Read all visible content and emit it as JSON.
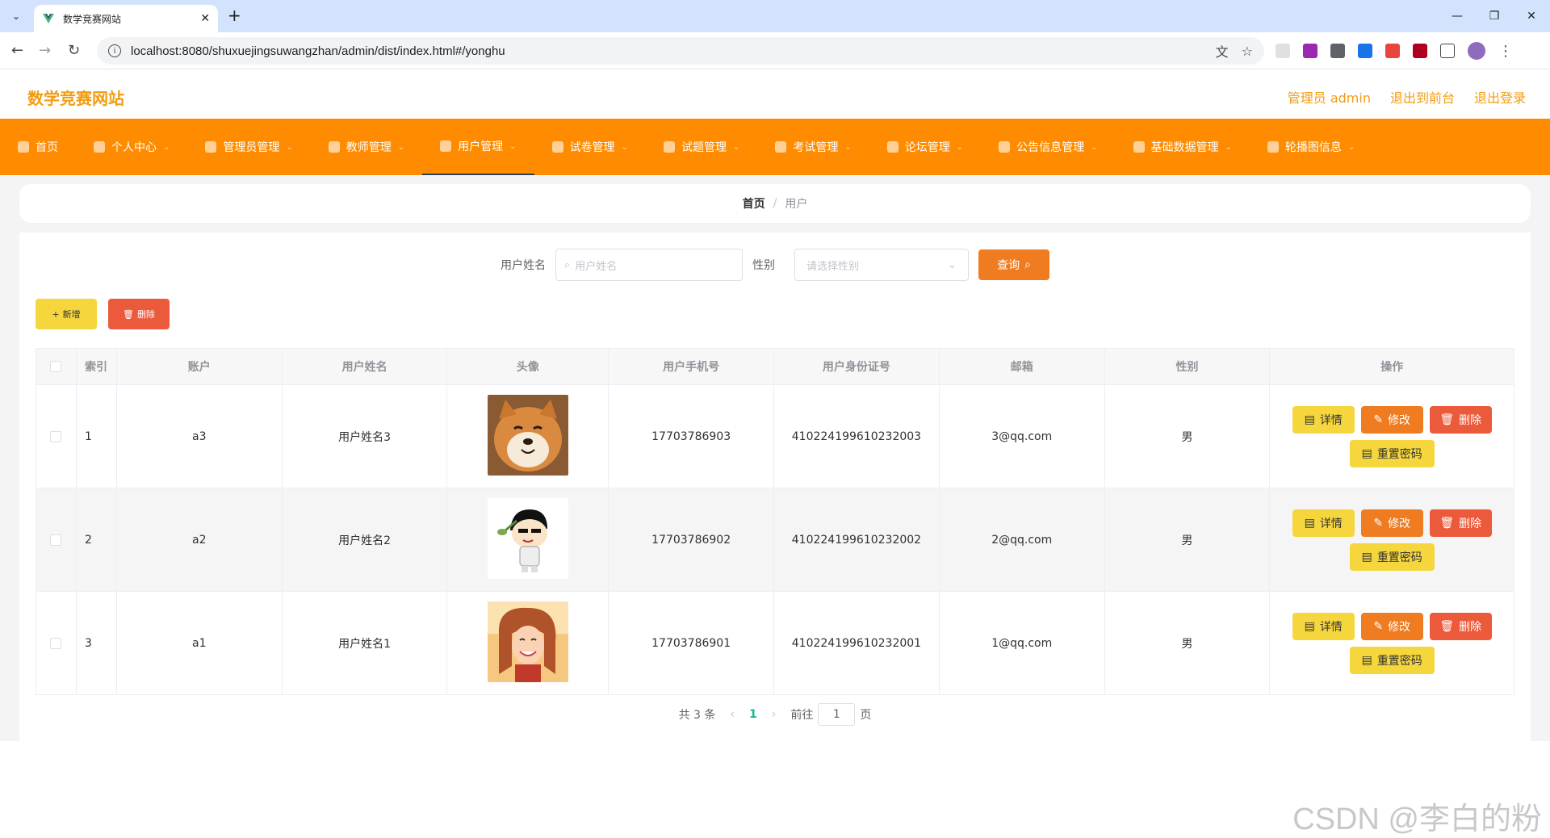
{
  "browser": {
    "tab_title": "数学竞赛网站",
    "url": "localhost:8080/shuxuejingsuwangzhan/admin/dist/index.html#/yonghu"
  },
  "header": {
    "site_title": "数学竞赛网站",
    "links": [
      "管理员 admin",
      "退出到前台",
      "退出登录"
    ]
  },
  "menu": {
    "items": [
      {
        "label": "首页",
        "has_arrow": false
      },
      {
        "label": "个人中心",
        "has_arrow": true
      },
      {
        "label": "管理员管理",
        "has_arrow": true
      },
      {
        "label": "教师管理",
        "has_arrow": true
      },
      {
        "label": "用户管理",
        "has_arrow": true,
        "active": true
      },
      {
        "label": "试卷管理",
        "has_arrow": true
      },
      {
        "label": "试题管理",
        "has_arrow": true
      },
      {
        "label": "考试管理",
        "has_arrow": true
      },
      {
        "label": "论坛管理",
        "has_arrow": true
      },
      {
        "label": "公告信息管理",
        "has_arrow": true
      },
      {
        "label": "基础数据管理",
        "has_arrow": true
      },
      {
        "label": "轮播图信息",
        "has_arrow": true
      }
    ]
  },
  "breadcrumb": {
    "home": "首页",
    "sep": "/",
    "current": "用户"
  },
  "search": {
    "name_label": "用户姓名",
    "name_placeholder": "用户姓名",
    "gender_label": "性别",
    "gender_placeholder": "请选择性别",
    "query_label": "查询"
  },
  "actions": {
    "add_label": "新增",
    "delete_label": "删除"
  },
  "table": {
    "headers": [
      "索引",
      "账户",
      "用户姓名",
      "头像",
      "用户手机号",
      "用户身份证号",
      "邮箱",
      "性别",
      "操作"
    ],
    "rows": [
      {
        "index": "1",
        "account": "a3",
        "name": "用户姓名3",
        "avatar": "shiba-dog",
        "phone": "17703786903",
        "id_number": "410224199610232003",
        "email": "3@qq.com",
        "gender": "男"
      },
      {
        "index": "2",
        "account": "a2",
        "name": "用户姓名2",
        "avatar": "cartoon-boy",
        "phone": "17703786902",
        "id_number": "410224199610232002",
        "email": "2@qq.com",
        "gender": "男"
      },
      {
        "index": "3",
        "account": "a1",
        "name": "用户姓名1",
        "avatar": "smiling-girl",
        "phone": "17703786901",
        "id_number": "410224199610232001",
        "email": "1@qq.com",
        "gender": "男"
      }
    ],
    "ops": {
      "detail": "详情",
      "edit": "修改",
      "delete": "删除",
      "reset": "重置密码"
    }
  },
  "pagination": {
    "total_text": "共 3 条",
    "current_page": "1",
    "goto_label": "前往",
    "goto_value": "1",
    "page_suffix": "页"
  },
  "watermark": "CSDN @李白的粉",
  "colors": {
    "accent": "#ff8c00",
    "title": "#f39c12",
    "yellow_btn": "#f5d63d",
    "orange_btn": "#f07c22",
    "red_btn": "#ec5a3c"
  }
}
